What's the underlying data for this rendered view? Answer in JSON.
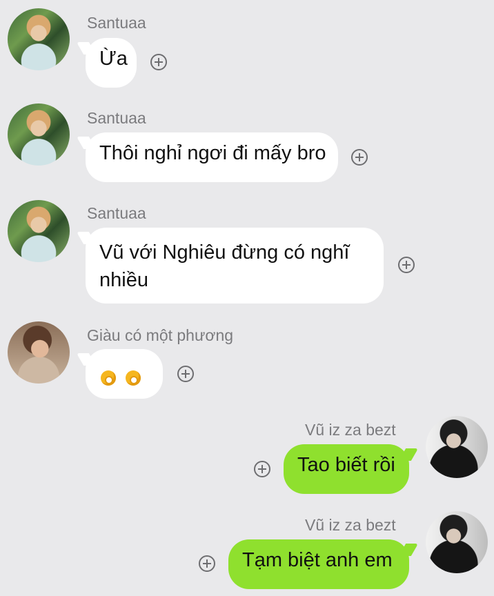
{
  "messages": [
    {
      "sender": "Santuaa",
      "text": "Ừa",
      "mine": false,
      "avatar": "santuaa-avatar"
    },
    {
      "sender": "Santuaa",
      "text": "Thôi nghỉ ngơi đi mấy bro",
      "mine": false,
      "avatar": "santuaa-avatar"
    },
    {
      "sender": "Santuaa",
      "text": "Vũ với Nghiêu đừng có nghĩ nhiều",
      "mine": false,
      "avatar": "santuaa-avatar"
    },
    {
      "sender": "Giàu có một phương",
      "text": "👌👌",
      "mine": false,
      "avatar": "giau-avatar"
    },
    {
      "sender": "Vũ iz za bezt",
      "text": "Tao biết rồi",
      "mine": true,
      "avatar": "vu-avatar"
    },
    {
      "sender": "Vũ iz za bezt",
      "text": "Tạm biệt anh em",
      "mine": true,
      "avatar": "vu-avatar"
    }
  ],
  "icons": {
    "reaction": "add-reaction-icon",
    "ok_hand": "ok-hand-emoji-icon"
  },
  "colors": {
    "background": "#e9e9eb",
    "incoming_bubble": "#ffffff",
    "outgoing_bubble": "#8fe02e"
  }
}
